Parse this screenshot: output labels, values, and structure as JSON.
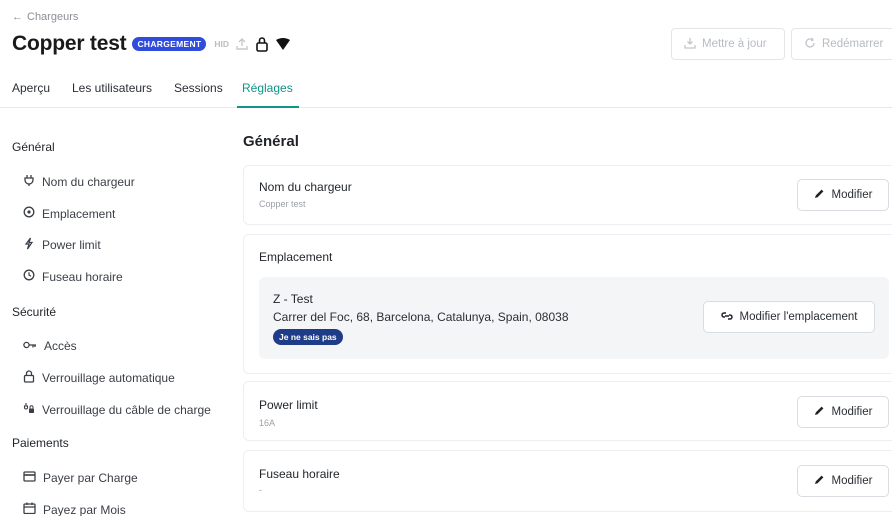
{
  "header": {
    "back_label": "Chargeurs",
    "title": "Copper test",
    "status_badge": "CHARGEMENT",
    "hid_label": "HID",
    "update_button": "Mettre à jour",
    "restart_button": "Redémarrer"
  },
  "tabs": [
    {
      "label": "Aperçu"
    },
    {
      "label": "Les utilisateurs"
    },
    {
      "label": "Sessions"
    },
    {
      "label": "Réglages",
      "active": true
    }
  ],
  "sidebar": {
    "sections": [
      {
        "title": "Général",
        "items": [
          {
            "label": "Nom du chargeur",
            "icon": "plug-icon"
          },
          {
            "label": "Emplacement",
            "icon": "location-target-icon"
          },
          {
            "label": "Power limit",
            "icon": "bolt-icon"
          },
          {
            "label": "Fuseau horaire",
            "icon": "clock-icon"
          }
        ]
      },
      {
        "title": "Sécurité",
        "items": [
          {
            "label": "Accès",
            "icon": "key-icon"
          },
          {
            "label": "Verrouillage automatique",
            "icon": "lock-icon"
          },
          {
            "label": "Verrouillage du câble de charge",
            "icon": "cable-lock-icon"
          }
        ]
      },
      {
        "title": "Paiements",
        "items": [
          {
            "label": "Payer par Charge",
            "icon": "card-icon"
          },
          {
            "label": "Payez par Mois",
            "icon": "calendar-icon"
          }
        ]
      }
    ]
  },
  "main": {
    "title": "Général",
    "edit_label": "Modifier",
    "cards": {
      "name": {
        "label": "Nom du chargeur",
        "value": "Copper test"
      },
      "location": {
        "label": "Emplacement",
        "place_name": "Z - Test",
        "address": "Carrer del Foc, 68, Barcelona, Catalunya, Spain, 08038",
        "tag": "Je ne sais pas",
        "button": "Modifier l'emplacement"
      },
      "power": {
        "label": "Power limit",
        "value": "16A"
      },
      "timezone": {
        "label": "Fuseau horaire",
        "value": "-"
      }
    }
  },
  "colors": {
    "accent": "#0e9488",
    "status_badge": "#2f4cdd",
    "location_tag": "#1f3c88"
  }
}
